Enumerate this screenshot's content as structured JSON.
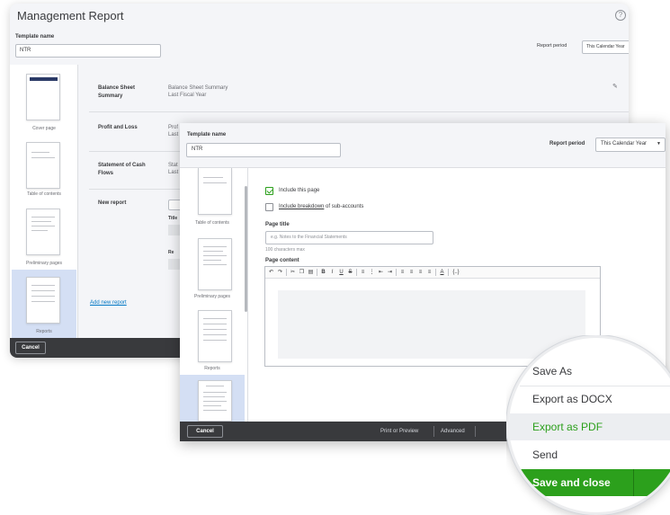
{
  "back_window": {
    "title": "Management Report",
    "template_name_label": "Template name",
    "template_name_value": "NTR",
    "report_period_label": "Report period",
    "report_period_value": "This Calendar Year",
    "thumbnails": [
      {
        "caption": "Cover page"
      },
      {
        "caption": "Table of contents"
      },
      {
        "caption": "Preliminary pages"
      },
      {
        "caption": "Reports"
      }
    ],
    "rows": [
      {
        "title_line1": "Balance Sheet",
        "title_line2": "Summary",
        "value_line1": "Balance Sheet Summary",
        "value_line2": "Last Fiscal Year"
      },
      {
        "title_line1": "Profit and Loss",
        "title_line2": "",
        "value_line1": "Prof",
        "value_line2": "Last"
      },
      {
        "title_line1": "Statement of Cash",
        "title_line2": "Flows",
        "value_line1": "Stat",
        "value_line2": "Last"
      },
      {
        "title_line1": "New report",
        "title_line2": "",
        "value_line1": "",
        "value_line2": ""
      }
    ],
    "partial_labels": {
      "title": "Title",
      "period": "Re"
    },
    "add_new_report": "Add new report",
    "cancel": "Cancel"
  },
  "front_window": {
    "template_name_label": "Template name",
    "template_name_value": "NTR",
    "report_period_label": "Report period",
    "report_period_value": "This Calendar Year",
    "thumbnails": [
      {
        "caption": "Table of contents"
      },
      {
        "caption": "Preliminary pages"
      },
      {
        "caption": "Reports"
      }
    ],
    "include_page": "Include this page",
    "include_breakdown_link": "Include breakdown",
    "include_breakdown_rest": " of sub-accounts",
    "page_title_label": "Page title",
    "page_title_placeholder": "e.g. Notes to the Financial Statements",
    "char_limit": "100 characters max",
    "page_content_label": "Page content",
    "toolbar_buttons": [
      "B",
      "I",
      "U",
      "S"
    ],
    "footer": {
      "cancel": "Cancel",
      "print_preview": "Print or Preview",
      "advanced": "Advanced"
    }
  },
  "save_menu": {
    "items": [
      "Save As",
      "Export as DOCX",
      "Export as PDF",
      "Send"
    ],
    "highlighted_index": 2,
    "primary_button": "Save and close"
  },
  "colors": {
    "brand_green": "#2ca01c",
    "footer_dark": "#393a3d",
    "selected_thumb": "#d4dff4",
    "link_blue": "#0077c5"
  }
}
